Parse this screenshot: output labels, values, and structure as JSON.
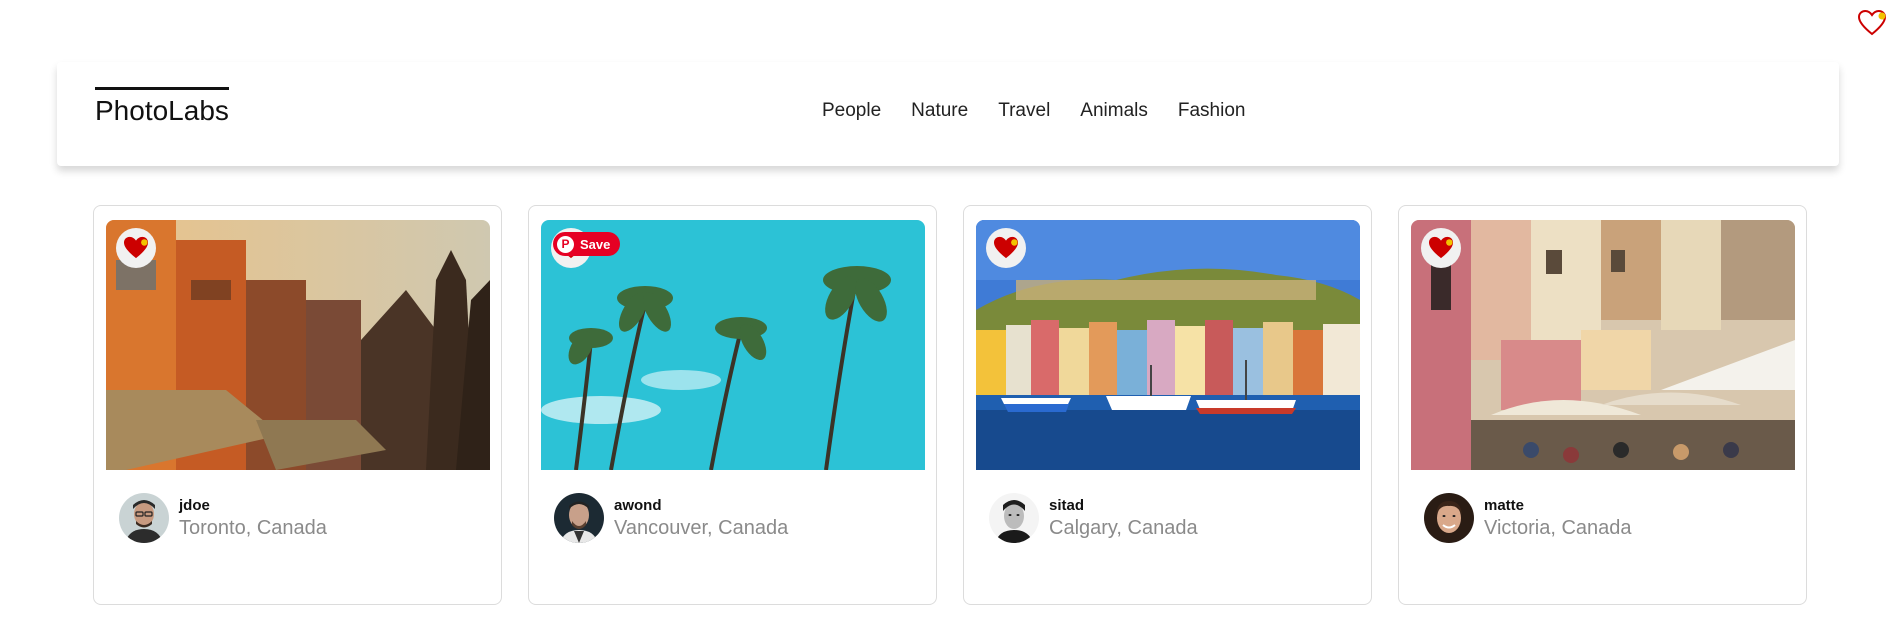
{
  "app": {
    "logo": "PhotoLabs"
  },
  "nav": {
    "topics": [
      "People",
      "Nature",
      "Travel",
      "Animals",
      "Fashion"
    ]
  },
  "corner_icon": "heart-outline-icon",
  "photos": [
    {
      "username": "jdoe",
      "location": "Toronto, Canada",
      "favorited": true,
      "icon": "heart-icon"
    },
    {
      "username": "awond",
      "location": "Vancouver, Canada",
      "favorited": true,
      "icon": "heart-icon",
      "save_label": "Save"
    },
    {
      "username": "sitad",
      "location": "Calgary, Canada",
      "favorited": true,
      "icon": "heart-icon"
    },
    {
      "username": "matte",
      "location": "Victoria, Canada",
      "favorited": true,
      "icon": "heart-icon"
    }
  ],
  "colors": {
    "heart": "#cc0000",
    "pinterest": "#e60023",
    "location_text": "#8a8a8a"
  }
}
